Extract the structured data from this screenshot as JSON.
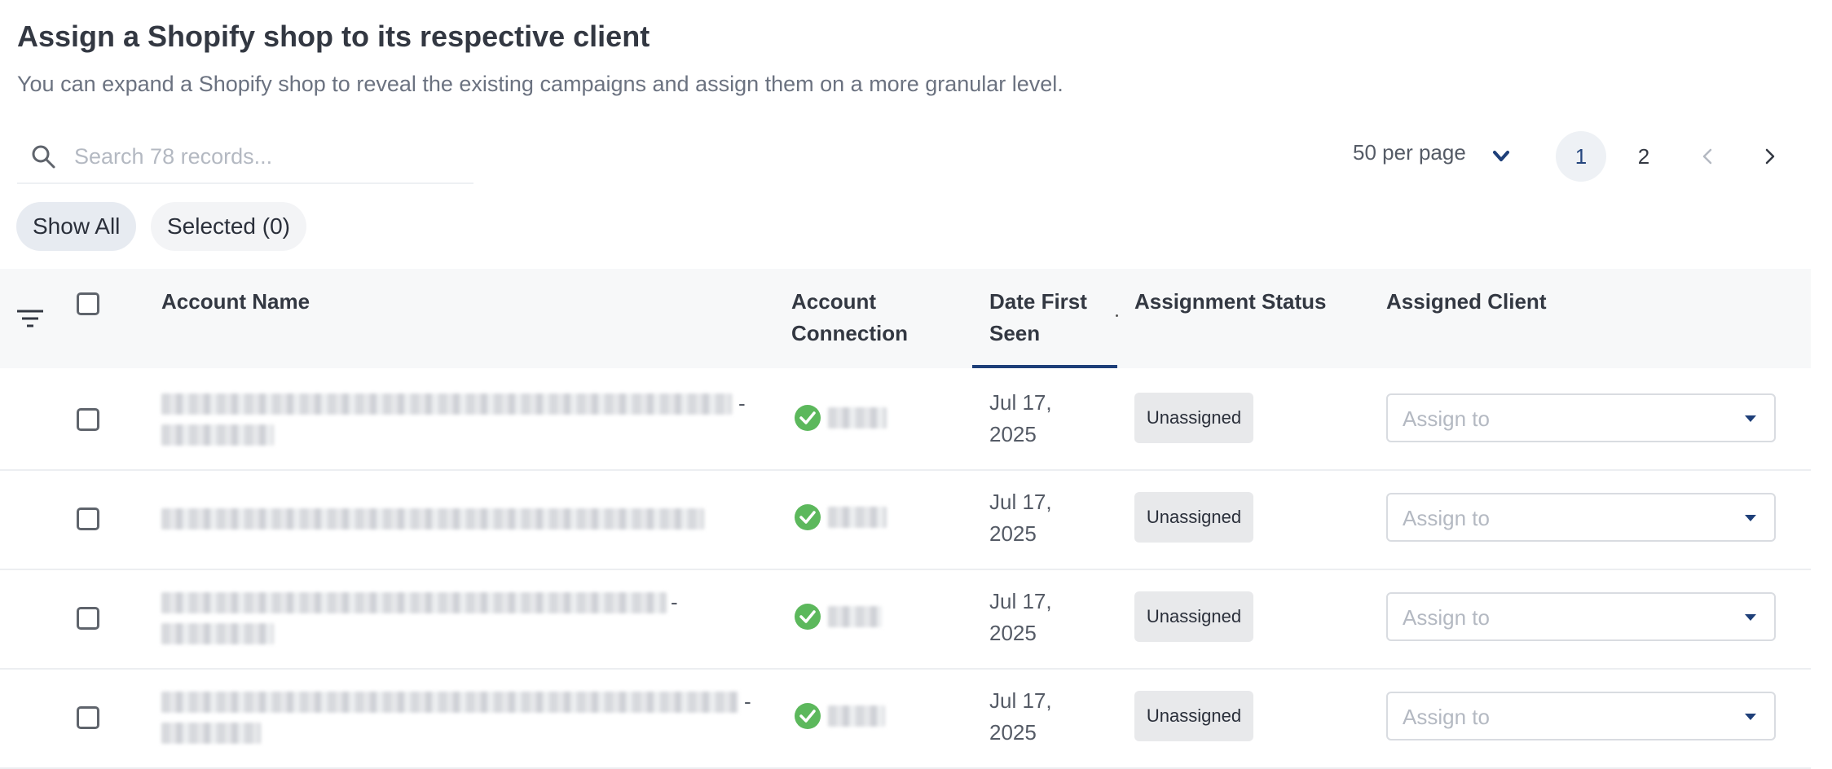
{
  "header": {
    "title": "Assign a Shopify shop to its respective client",
    "subtitle": "You can expand a Shopify shop to reveal the existing campaigns and assign them on a more granular level."
  },
  "search": {
    "placeholder": "Search 78 records...",
    "icon": "search-icon"
  },
  "pagination": {
    "per_page_label": "50 per page",
    "pages": [
      "1",
      "2"
    ],
    "current_page": "1"
  },
  "filters": {
    "show_all": "Show All",
    "selected": "Selected (0)"
  },
  "table": {
    "columns": {
      "account_name": "Account Name",
      "account_connection": "Account Connection",
      "date_first_seen": "Date First Seen",
      "assignment_status": "Assignment Status",
      "assigned_client": "Assigned Client"
    },
    "rows": [
      {
        "name_suffix": "-",
        "date_line1": "Jul 17,",
        "date_line2": "2025",
        "status": "Unassigned",
        "assign_placeholder": "Assign to"
      },
      {
        "name_suffix": "",
        "date_line1": "Jul 17,",
        "date_line2": "2025",
        "status": "Unassigned",
        "assign_placeholder": "Assign to"
      },
      {
        "name_suffix": "-",
        "date_line1": "Jul 17,",
        "date_line2": "2025",
        "status": "Unassigned",
        "assign_placeholder": "Assign to"
      },
      {
        "name_suffix": "-",
        "date_line1": "Jul 17,",
        "date_line2": "2025",
        "status": "Unassigned",
        "assign_placeholder": "Assign to"
      }
    ]
  },
  "colors": {
    "accent": "#1e3f79",
    "success": "#5cb85c",
    "badge_bg": "#e8e9eb"
  }
}
